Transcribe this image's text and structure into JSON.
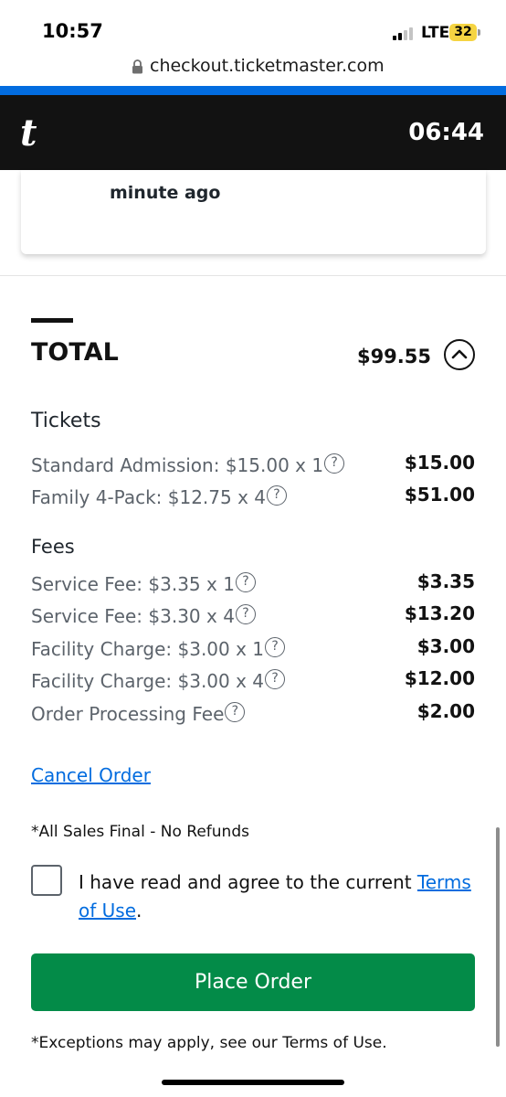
{
  "status_bar": {
    "time": "10:57",
    "network": "LTE",
    "battery": "32"
  },
  "browser": {
    "url": "checkout.ticketmaster.com"
  },
  "header": {
    "logo": "t",
    "timer": "06:44"
  },
  "card": {
    "text_line": "minute ago"
  },
  "total": {
    "label": "TOTAL",
    "amount": "$99.55"
  },
  "tickets": {
    "title": "Tickets",
    "rows": [
      {
        "label": "Standard Admission: $15.00 x 1",
        "value": "$15.00"
      },
      {
        "label": "Family 4-Pack: $12.75 x 4",
        "value": "$51.00"
      }
    ]
  },
  "fees": {
    "title": "Fees",
    "rows": [
      {
        "label": "Service Fee: $3.35 x 1",
        "value": "$3.35"
      },
      {
        "label": "Service Fee: $3.30 x 4",
        "value": "$13.20"
      },
      {
        "label": "Facility Charge: $3.00 x 1",
        "value": "$3.00"
      },
      {
        "label": "Facility Charge: $3.00 x 4",
        "value": "$12.00"
      },
      {
        "label": "Order Processing Fee",
        "value": "$2.00"
      }
    ]
  },
  "help_glyph": "?",
  "actions": {
    "cancel_label": "Cancel Order",
    "sales_final": "*All Sales Final - No Refunds",
    "agree_text": "I have read and agree to the current ",
    "terms_link": "Terms of Use",
    "agree_suffix": ".",
    "place_order_label": "Place Order",
    "exceptions": "*Exceptions may apply, see our Terms of Use."
  },
  "colors": {
    "brand_blue": "#026cdf",
    "header_black": "#121212",
    "place_order_green": "#038b48",
    "battery_yellow": "#f5d442"
  }
}
